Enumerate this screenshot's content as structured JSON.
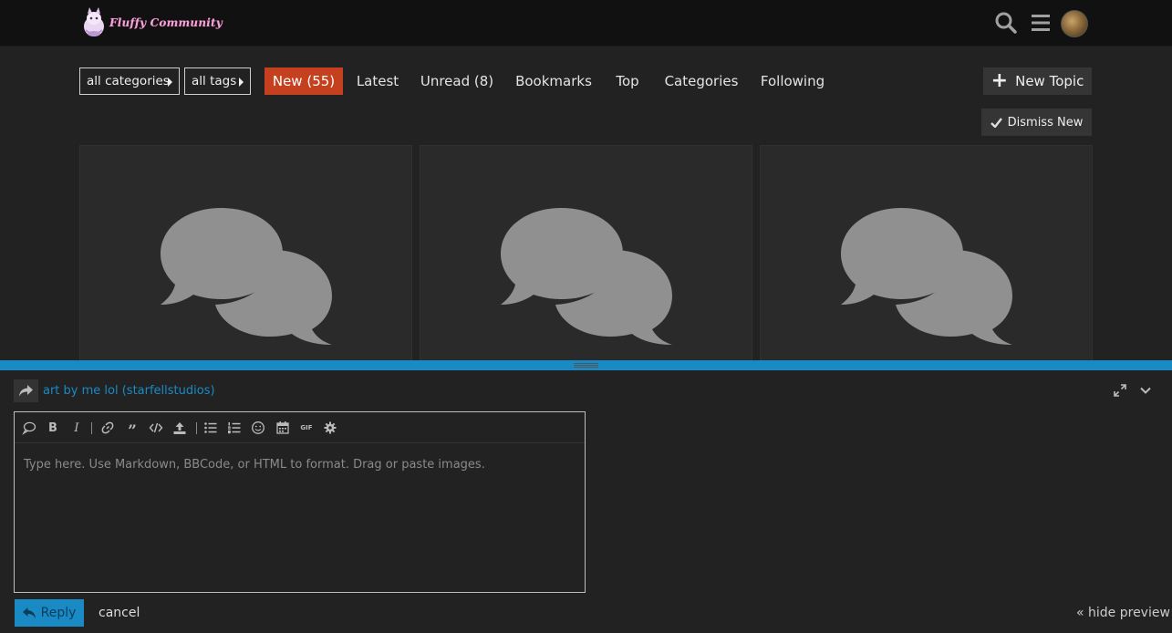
{
  "header": {
    "site_name": "Fluffy Community",
    "icons": [
      "search-icon",
      "hamburger-menu-icon",
      "avatar"
    ]
  },
  "nav": {
    "category_dropdown": "all categories",
    "tags_dropdown": "all tags",
    "items": [
      {
        "label": "New (55)",
        "active": true
      },
      {
        "label": "Latest",
        "active": false
      },
      {
        "label": "Unread (8)",
        "active": false
      },
      {
        "label": "Bookmarks",
        "active": false
      },
      {
        "label": "Top",
        "active": false
      },
      {
        "label": "Categories",
        "active": false
      },
      {
        "label": "Following",
        "active": false
      }
    ],
    "new_topic_label": "New Topic",
    "dismiss_new_label": "Dismiss New"
  },
  "cards": [
    {
      "icon": "comments-icon"
    },
    {
      "icon": "comments-icon"
    },
    {
      "icon": "comments-icon"
    }
  ],
  "composer": {
    "reply_to": "art by me lol (starfellstudios)",
    "placeholder": "Type here. Use Markdown, BBCode, or HTML to format. Drag or paste images.",
    "toolbar": [
      "quote-icon",
      "bold-icon",
      "italic-icon",
      "link-icon",
      "blockquote-icon",
      "code-icon",
      "upload-icon",
      "bullet-list-icon",
      "numbered-list-icon",
      "emoji-icon",
      "calendar-icon",
      "gif-icon",
      "gear-icon"
    ],
    "gif_label": "GIF",
    "reply_label": "Reply",
    "cancel_label": "cancel",
    "hide_preview_label": "« hide preview"
  },
  "colors": {
    "accent": "#1a8ac4",
    "active_nav": "#c4401e",
    "header_bg": "#111111",
    "page_bg": "#222222"
  }
}
